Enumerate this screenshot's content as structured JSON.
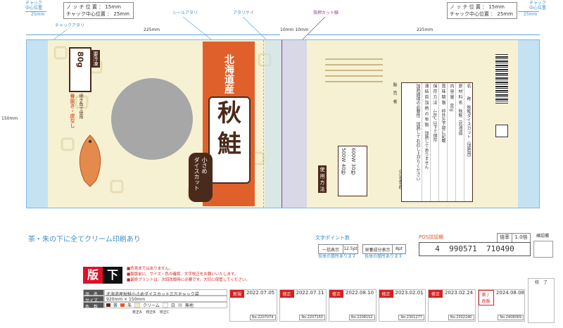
{
  "header": {
    "chuck_center_left": "チャック\n中心位置",
    "left_box": [
      "ノ ッ チ 位 置 ： 15mm",
      "チャック中心位置 ： 25mm"
    ],
    "right_box": [
      "ノ ッ チ 位 置 ： 15mm",
      "チャック中心位置 ： 25mm"
    ],
    "chuck_center_right": "チャック\n中心位置",
    "dim_25_left": "25mm",
    "dim_25_right": "25mm",
    "seal_label": "シールアタリ",
    "notch_label": "アタリケイ",
    "foil_label": "箔押カット線",
    "chuck_label": "チャックアタリ",
    "dim_225_left": "225mm",
    "dim_10_10": "10mm 10mm",
    "dim_225_right": "225mm",
    "dim_150": "150mm"
  },
  "front": {
    "origin": "北海道産",
    "product_a": "秋",
    "product_b": "鮭",
    "sub": "小さめ\nダイスカット",
    "weight": "80g",
    "storage": "要冷凍",
    "onestep": "一度使いき",
    "feature": "骨抜き・皮なし",
    "feature2": "焼き魚で使用"
  },
  "back": {
    "usage_title": "使 用 方 法",
    "cook_table": [
      "500W 40秒",
      "600W 30秒"
    ],
    "info_title": "（冷凍食品）",
    "info_rows": [
      "名　　称　秋鮭ダイスカット（加熱用）",
      "原 材 料 名　秋鮭（北海道）",
      "内 容 量　80g",
      "賞 味 期 限　枠外左下部に記載",
      "保 存 方 法　-18℃以下で保存",
      "凍 結 前 加 熱 の 有 無　加熱してありません",
      "加熱調理の必要性　加熱してお召し上がりください"
    ],
    "maker": "販　売　者"
  },
  "footer": {
    "cream_note": "茶・朱の下に全てクリーム印刷あり",
    "text_point": "文字ポイント数",
    "one_line": "一括表示",
    "one_line_pt": "12.5pt",
    "nutrition": "栄養成分表示",
    "nutrition_pt": "8pt",
    "check1": "長体の箇所あります",
    "check2": "長体の箇所あります",
    "pos": "POS詳認欄",
    "magnify": "倍率",
    "magnify_val": "1.0倍",
    "barcode_digits": "4  990571  710490",
    "check_box": "確認欄",
    "han": "版",
    "shita": "下",
    "notes": [
      "■色見本ではありません。",
      "■製版前に、サイズ・色の確認、文字校正をお願いいたします。",
      "■最終プリントは、次回改版時に必要です。大切に保管してください。"
    ],
    "spec_label_name": "品　名",
    "spec_name": "北海道産秋鮭小さめダイスカット三方チャック袋",
    "spec_label_size": "サイズ",
    "spec_size": "920mm × 150mm",
    "spec_label_color": "色　数",
    "colors": [
      "茶",
      "朱",
      "クリーム",
      "白",
      "無地"
    ],
    "color_swatches": [
      "#5a2c1a",
      "#e25b2a",
      "#f4ecc4",
      "#ffffff",
      "#cccccc"
    ],
    "proof_labels": [
      "校正A",
      "校正B",
      "校正C"
    ],
    "revisions": [
      {
        "label": "新規",
        "date": "2022.07.05",
        "no": "No.2207074"
      },
      {
        "label": "修正",
        "date": "2022.07.11",
        "no": "No.2207150"
      },
      {
        "label": "修正",
        "date": "2022.08.10",
        "no": "No.2208152"
      },
      {
        "label": "修正",
        "date": "2023.02.01",
        "no": "No.2301277"
      },
      {
        "label": "修正",
        "date": "2023.02.24",
        "no": "No.2302240"
      },
      {
        "label": "茶 / 改版",
        "date": "2024.08.08",
        "no": "No.2408069"
      }
    ],
    "sign": "校　了"
  }
}
